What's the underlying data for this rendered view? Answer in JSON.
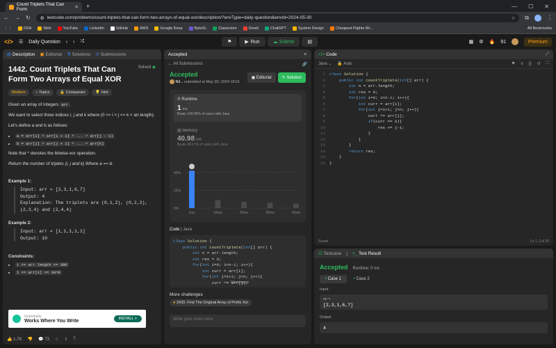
{
  "browser": {
    "tab_title": "Count Triplets That Can Form",
    "url": "leetcode.com/problems/count-triplets-that-can-form-two-arrays-of-equal-xor/description/?envType=daily-question&envId=2024-05-30",
    "bookmarks": [
      "DSA",
      "Web",
      "YouTube",
      "LinkedIn",
      "GitHub",
      "AWS",
      "Google Keep",
      "ByteXL",
      "Classroom",
      "Gmail",
      "ChatGPT",
      "System Design",
      "Cheapest Flights Wi..."
    ],
    "bookmark_colors": [
      "#f4b400",
      "#f4b400",
      "#ff0000",
      "#0a66c2",
      "#ffffff",
      "#ff9900",
      "#fbbc04",
      "#6a5acd",
      "#0f9d58",
      "#ea4335",
      "#10a37f",
      "#f4b400",
      "#ff7a00"
    ],
    "all_bookmarks": "All Bookmarks"
  },
  "header": {
    "daily": "Daily Question",
    "run": "Run",
    "submit": "Submit",
    "streak": "91",
    "premium": "Premium"
  },
  "left": {
    "tabs": [
      "Description",
      "Editorial",
      "Solutions",
      "Submissions"
    ],
    "title": "1442. Count Triplets That Can Form Two Arrays of Equal XOR",
    "solved": "Solved",
    "difficulty": "Medium",
    "chips": [
      "Topics",
      "Companies",
      "Hint"
    ],
    "intro": "Given an array of integers",
    "intro_code": "arr",
    "select": "We want to select three indices i, j and k where (0 <= i < j <= k < arr.length).",
    "define": "Let's define a and b as follows:",
    "bullet_a": "a = arr[i] ^ arr[i + 1] ^ ... ^ arr[j - 1]",
    "bullet_b": "b = arr[j] ^ arr[j + 1] ^ ... ^ arr[k]",
    "note": "Note that ^ denotes the bitwise-xor operation.",
    "ret": "Return the number of triplets (i, j and k) Where a == b.",
    "ex1_title": "Example 1:",
    "ex1_in": "Input: arr = [2,3,1,6,7]",
    "ex1_out": "Output: 4",
    "ex1_exp": "Explanation: The triplets are (0,1,2), (0,2,2), (2,3,4) and (2,4,4)",
    "ex2_title": "Example 2:",
    "ex2_in": "Input: arr = [1,1,1,1,1]",
    "ex2_out": "Output: 10",
    "constraints_title": "Constraints:",
    "c1": "1 <= arr.length <= 300",
    "c2": "1 <= arr[i] <= 10^8",
    "ad_brand": "Grammarly",
    "ad_text": "Works Where You Write",
    "ad_btn": "INSTALL >",
    "likes": "1.7K",
    "comments": "73"
  },
  "middle": {
    "tab": "Accepted",
    "all_sub": "All Submissions",
    "status": "Accepted",
    "user": "Nil...",
    "submitted": "submitted at May 30, 2024 18:01",
    "editorial": "Editorial",
    "solution": "Solution",
    "runtime_label": "Runtime",
    "runtime_val": "1",
    "runtime_unit": "ms",
    "runtime_beats": "Beats 100.00% of users with Java",
    "memory_label": "Memory",
    "memory_val": "40.98",
    "memory_unit": "MB",
    "memory_beats": "Beats 48.57% of users with Java",
    "y_ticks": [
      "40%",
      "20%",
      "0%"
    ],
    "x_ticks": [
      "1ms",
      "10ms",
      "20ms",
      "35ms",
      "41ms"
    ],
    "code_label": "Code",
    "code_lang": "Java",
    "code_lines": [
      "class Solution {",
      "    public int countTriplets(int[] arr) {",
      "        int n = arr.length;",
      "        int res = 0;",
      "        for(int i=0; i<n-1; i++){",
      "            int curr = arr[i];",
      "            for(int j=i+1; j<n; j++){",
      "                curr ^= arr[j];"
    ],
    "view_more": "View more",
    "more_title": "More challenges",
    "more_item": "2433. Find The Original Array of Prefix Xor",
    "notes_ph": "Write your notes here"
  },
  "right": {
    "code_tab": "Code",
    "lang": "Java",
    "auto": "Auto",
    "lines": [
      "class Solution {",
      "    public int countTriplets(int[] arr) {",
      "        int n = arr.length;",
      "        int res = 0;",
      "        for(int i=0; i<n-1; i++){",
      "            int curr = arr[i];",
      "            for(int j=i+1; j<n; j++){",
      "                curr ^= arr[j];",
      "                if(curr == 0){",
      "                    res += j-i;",
      "                }",
      "            }",
      "        }",
      "        return res;",
      "    }",
      "}"
    ],
    "saved": "Saved",
    "cursor": "Ln 1, Col 26",
    "tc_tab": "Testcase",
    "res_tab": "Test Result",
    "result": "Accepted",
    "result_rt": "Runtime: 0 ms",
    "case1": "Case 1",
    "case2": "Case 2",
    "input_label": "Input",
    "input_var": "arr =",
    "input_val": "[2,3,1,6,7]",
    "output_label": "Output",
    "output_val": "4"
  },
  "chart_data": {
    "type": "bar",
    "categories": [
      "1ms",
      "10ms",
      "20ms",
      "35ms",
      "41ms"
    ],
    "y_ticks": [
      "0%",
      "20%",
      "40%"
    ],
    "ylim": [
      0,
      50
    ],
    "values": [
      42,
      9,
      7,
      6,
      5
    ]
  }
}
